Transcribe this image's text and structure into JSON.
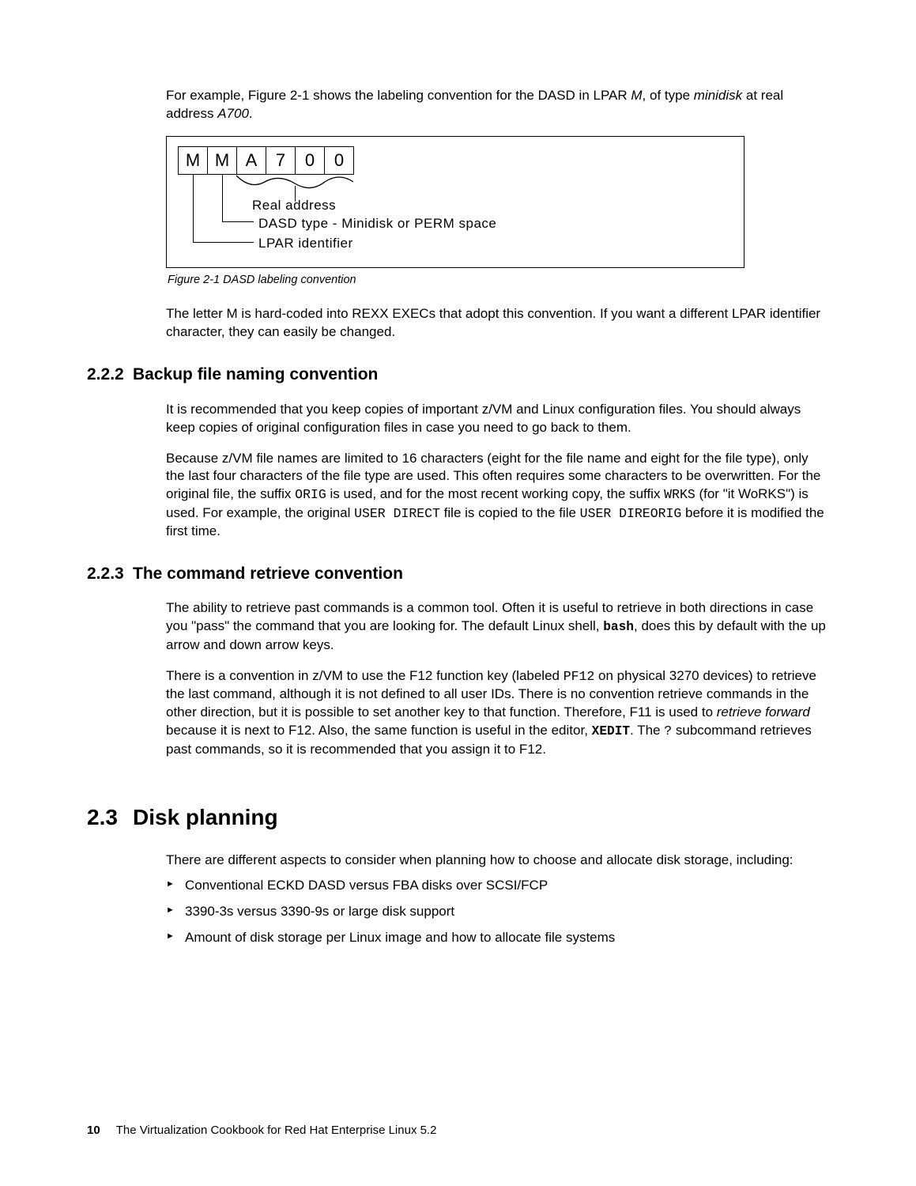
{
  "intro": {
    "p1a": "For example, Figure 2-1 shows the labeling convention for the DASD in LPAR ",
    "p1b": ", of type ",
    "p1c": " at real address ",
    "p1d": ".",
    "lpar": "M",
    "type": "minidisk",
    "addr": "A700"
  },
  "figure": {
    "cells": [
      "M",
      "M",
      "A",
      "7",
      "0",
      "0"
    ],
    "label_real": "Real address",
    "label_type": "DASD type - Minidisk or PERM space",
    "label_lpar": "LPAR identifier",
    "caption": "Figure 2-1   DASD labeling convention"
  },
  "after_fig": "The letter M is hard-coded into REXX EXECs that adopt this convention. If you want a different LPAR identifier character, they can easily be changed.",
  "s222": {
    "num": "2.2.2",
    "title": "Backup file naming convention",
    "p1": "It is recommended that you keep copies of important z/VM and Linux configuration files. You should always keep copies of original configuration files in case you need to go back to them.",
    "p2a": "Because z/VM file names are limited to 16 characters (eight for the file name and eight for the file type), only the last four characters of the file type are used. This often requires some characters to be overwritten. For the original file, the suffix ",
    "p2b": " is used, and for the most recent working copy, the suffix ",
    "p2c": " (for \"it WoRKS\") is used. For example, the original ",
    "p2d": " file is copied to the file ",
    "p2e": " before it is modified the first time.",
    "orig": "ORIG",
    "wrks": "WRKS",
    "ud": "USER DIRECT",
    "udo": "USER DIREORIG"
  },
  "s223": {
    "num": "2.2.3",
    "title": "The command retrieve convention",
    "p1a": "The ability to retrieve past commands is a common tool. Often it is useful to retrieve in both directions in case you \"pass\" the command that you are looking for. The default Linux shell, ",
    "p1b": ", does this by default with the up arrow and down arrow keys.",
    "bash": "bash",
    "p2a": "There is a convention in z/VM to use the F12 function key (labeled ",
    "p2b": " on physical 3270 devices) to retrieve the last command, although it is not defined to all user IDs. There is no convention retrieve commands in the other direction, but it is possible to set another key to that function. Therefore, F11 is used to ",
    "p2c": " because it is next to F12. Also, the same function is useful in the editor, ",
    "p2d": ". The ",
    "p2e": " subcommand retrieves past commands, so it is recommended that you assign it to F12.",
    "pf12": "PF12",
    "rf": "retrieve forward",
    "xedit": "XEDIT",
    "q": "?"
  },
  "s23": {
    "num": "2.3",
    "title": "Disk planning",
    "p1": "There are different aspects to consider when planning how to choose and allocate disk storage, including:",
    "items": [
      "Conventional ECKD DASD versus FBA disks over SCSI/FCP",
      "3390-3s versus 3390-9s or large disk support",
      "Amount of disk storage per Linux image and how to allocate file systems"
    ]
  },
  "footer": {
    "page": "10",
    "title": "The Virtualization Cookbook for Red Hat Enterprise Linux 5.2"
  }
}
